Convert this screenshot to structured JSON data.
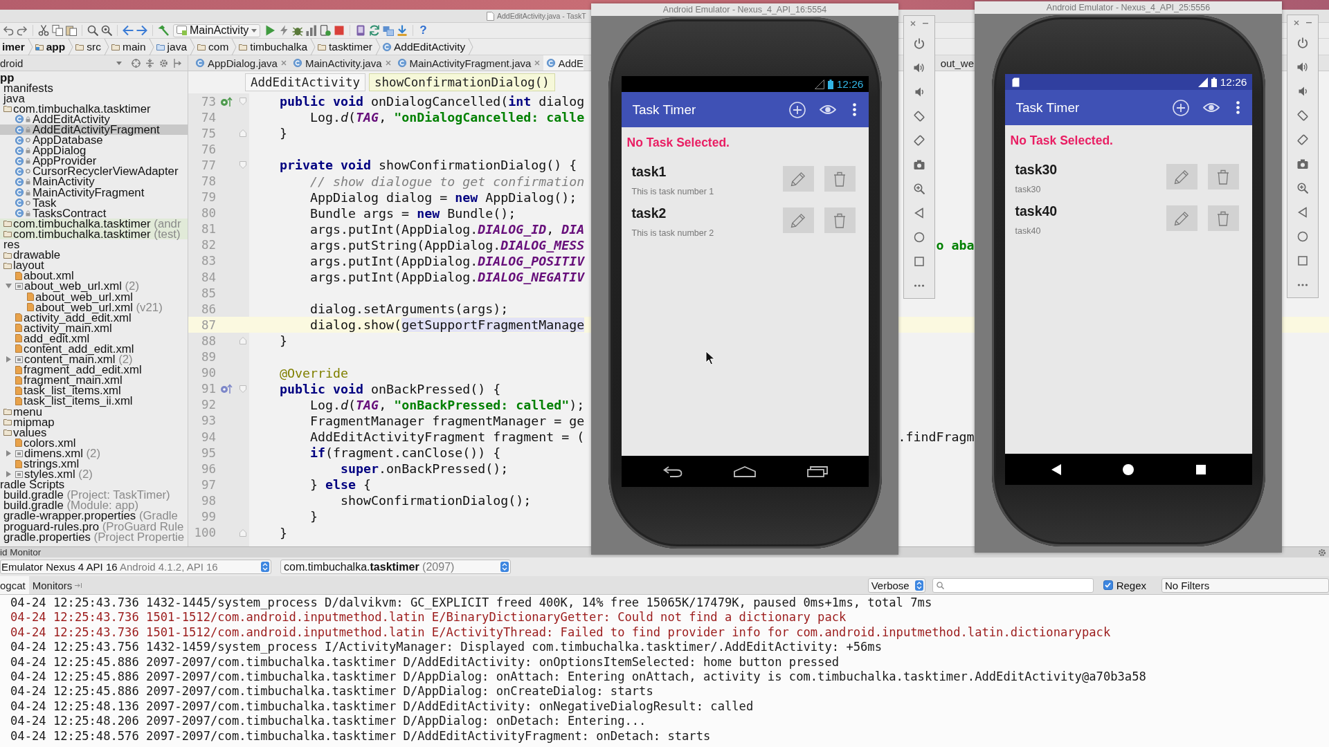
{
  "ide": {
    "window_title": "AddEditActivity.java - TaskT",
    "toolbar": {
      "run_config": "MainActivity",
      "help": "?"
    },
    "breadcrumbs": [
      {
        "label": "imer",
        "kind": "project"
      },
      {
        "label": "app",
        "kind": "module"
      },
      {
        "label": "src",
        "kind": "folder"
      },
      {
        "label": "main",
        "kind": "folder"
      },
      {
        "label": "java",
        "kind": "source-folder"
      },
      {
        "label": "com",
        "kind": "package"
      },
      {
        "label": "timbuchalka",
        "kind": "package"
      },
      {
        "label": "tasktimer",
        "kind": "package"
      },
      {
        "label": "AddEditActivity",
        "kind": "class"
      }
    ],
    "project_view": "droid",
    "tree": [
      {
        "label": "pp",
        "kind": "module",
        "selected": false,
        "children": [
          {
            "label": "manifests",
            "selected": false
          },
          {
            "label": "java",
            "selected": false,
            "children": [
              {
                "label": "com.timbuchalka.tasktimer",
                "kind": "package",
                "selected": false,
                "children": [
                  {
                    "label": "AddEditActivity",
                    "kind": "class",
                    "public": true,
                    "selected": false
                  },
                  {
                    "label": "AddEditActivityFragment",
                    "kind": "class",
                    "public": true,
                    "selected": true
                  },
                  {
                    "label": "AppDatabase",
                    "kind": "class",
                    "public": false,
                    "selected": false
                  },
                  {
                    "label": "AppDialog",
                    "kind": "class",
                    "public": true,
                    "selected": false
                  },
                  {
                    "label": "AppProvider",
                    "kind": "class",
                    "public": true,
                    "selected": false
                  },
                  {
                    "label": "CursorRecyclerViewAdapter",
                    "kind": "class",
                    "public": false,
                    "selected": false
                  },
                  {
                    "label": "MainActivity",
                    "kind": "class",
                    "public": true,
                    "selected": false
                  },
                  {
                    "label": "MainActivityFragment",
                    "kind": "class",
                    "public": true,
                    "selected": false
                  },
                  {
                    "label": "Task",
                    "kind": "class",
                    "public": false,
                    "selected": false
                  },
                  {
                    "label": "TasksContract",
                    "kind": "class",
                    "public": true,
                    "selected": false
                  }
                ]
              },
              {
                "label": "com.timbuchalka.tasktimer",
                "note": "(andr",
                "kind": "test-package",
                "selected": false
              },
              {
                "label": "com.timbuchalka.tasktimer",
                "note": "(test)",
                "kind": "test-package",
                "selected": false
              }
            ]
          },
          {
            "label": "res",
            "selected": false,
            "children": [
              {
                "label": "drawable",
                "kind": "folder",
                "selected": false
              },
              {
                "label": "layout",
                "kind": "folder",
                "selected": false,
                "children": [
                  {
                    "label": "about.xml",
                    "kind": "xml",
                    "selected": false
                  },
                  {
                    "label": "about_web_url.xml",
                    "note": "(2)",
                    "kind": "xml-group",
                    "expanded": true,
                    "selected": false,
                    "children": [
                      {
                        "label": "about_web_url.xml",
                        "kind": "xml",
                        "selected": false
                      },
                      {
                        "label": "about_web_url.xml",
                        "note": "(v21)",
                        "kind": "xml",
                        "selected": false
                      }
                    ]
                  },
                  {
                    "label": "activity_add_edit.xml",
                    "kind": "xml",
                    "selected": false
                  },
                  {
                    "label": "activity_main.xml",
                    "kind": "xml",
                    "selected": false
                  },
                  {
                    "label": "add_edit.xml",
                    "kind": "xml",
                    "selected": false
                  },
                  {
                    "label": "content_add_edit.xml",
                    "kind": "xml",
                    "selected": false
                  },
                  {
                    "label": "content_main.xml",
                    "note": "(2)",
                    "kind": "xml-group",
                    "expanded": false,
                    "selected": false
                  },
                  {
                    "label": "fragment_add_edit.xml",
                    "kind": "xml",
                    "selected": false
                  },
                  {
                    "label": "fragment_main.xml",
                    "kind": "xml",
                    "selected": false
                  },
                  {
                    "label": "task_list_items.xml",
                    "kind": "xml",
                    "selected": false
                  },
                  {
                    "label": "task_list_items_ii.xml",
                    "kind": "xml",
                    "selected": false
                  }
                ]
              },
              {
                "label": "menu",
                "kind": "folder",
                "selected": false
              },
              {
                "label": "mipmap",
                "kind": "folder",
                "selected": false
              },
              {
                "label": "values",
                "kind": "folder",
                "selected": false,
                "children": [
                  {
                    "label": "colors.xml",
                    "kind": "xml",
                    "selected": false
                  },
                  {
                    "label": "dimens.xml",
                    "note": "(2)",
                    "kind": "xml-group",
                    "expanded": false,
                    "selected": false
                  },
                  {
                    "label": "strings.xml",
                    "kind": "xml",
                    "selected": false
                  },
                  {
                    "label": "styles.xml",
                    "note": "(2)",
                    "kind": "xml-group",
                    "expanded": false,
                    "selected": false
                  }
                ]
              }
            ]
          }
        ]
      },
      {
        "label": "radle Scripts",
        "selected": false,
        "children": [
          {
            "label": "build.gradle",
            "note": "(Project: TaskTimer)",
            "selected": false
          },
          {
            "label": "build.gradle",
            "note": "(Module: app)",
            "selected": false
          },
          {
            "label": "gradle-wrapper.properties",
            "note": "(Gradle",
            "selected": false
          },
          {
            "label": "proguard-rules.pro",
            "note": "(ProGuard Rule",
            "selected": false
          },
          {
            "label": "gradle.properties",
            "note": "(Project Propertie",
            "selected": false
          }
        ]
      }
    ],
    "tabs": [
      {
        "label": "AppDialog.java",
        "selected": false
      },
      {
        "label": "MainActivity.java",
        "selected": false
      },
      {
        "label": "MainActivityFragment.java",
        "selected": false
      }
    ],
    "tab_under_emulator": {
      "label": "AddE",
      "selected": true
    },
    "tab_between_windows": "out_we",
    "code_breadcrumbs": [
      {
        "label": "AddEditActivity",
        "selected": false
      },
      {
        "label": "showConfirmationDialog()",
        "selected": true
      }
    ],
    "code_lines": [
      {
        "number": "73",
        "current": false,
        "gutter": [
          {
            "kind": "implements"
          },
          {
            "kind": "fold-start"
          }
        ],
        "code": [
          {
            "kind": "keyword",
            "text": "    public void "
          },
          {
            "kind": "plain",
            "text": "onDialogCancelled("
          },
          {
            "kind": "keyword",
            "text": "int "
          },
          {
            "kind": "plain",
            "text": "dialog"
          }
        ]
      },
      {
        "number": "74",
        "current": false,
        "code": [
          {
            "kind": "plain",
            "text": "        Log."
          },
          {
            "kind": "static",
            "text": "d"
          },
          {
            "kind": "plain",
            "text": "("
          },
          {
            "kind": "constant",
            "text": "TAG"
          },
          {
            "kind": "plain",
            "text": ", "
          },
          {
            "kind": "string",
            "text": "\"onDialogCancelled: calle"
          }
        ]
      },
      {
        "number": "75",
        "current": false,
        "gutter": [
          {
            "kind": "fold-end"
          }
        ],
        "code": [
          {
            "kind": "plain",
            "text": "    }"
          }
        ]
      },
      {
        "number": "76",
        "current": false
      },
      {
        "number": "77",
        "current": false,
        "gutter": [
          {
            "kind": "fold-start"
          }
        ],
        "code": [
          {
            "kind": "keyword",
            "text": "    private void "
          },
          {
            "kind": "plain",
            "text": "showConfirmationDialog() {"
          }
        ]
      },
      {
        "number": "78",
        "current": false,
        "code": [
          {
            "kind": "comment",
            "text": "        // show dialogue to get confirmation"
          }
        ]
      },
      {
        "number": "79",
        "current": false,
        "code": [
          {
            "kind": "plain",
            "text": "        AppDialog dialog = "
          },
          {
            "kind": "keyword",
            "text": "new "
          },
          {
            "kind": "plain",
            "text": "AppDialog();"
          }
        ]
      },
      {
        "number": "80",
        "current": false,
        "code": [
          {
            "kind": "plain",
            "text": "        Bundle args = "
          },
          {
            "kind": "keyword",
            "text": "new "
          },
          {
            "kind": "plain",
            "text": "Bundle();"
          }
        ]
      },
      {
        "number": "81",
        "current": false,
        "code": [
          {
            "kind": "plain",
            "text": "        args.putInt(AppDialog."
          },
          {
            "kind": "constant",
            "text": "DIALOG_ID"
          },
          {
            "kind": "plain",
            "text": ", "
          },
          {
            "kind": "constant",
            "text": "DIA"
          }
        ]
      },
      {
        "number": "82",
        "current": false,
        "code": [
          {
            "kind": "plain",
            "text": "        args.putString(AppDialog."
          },
          {
            "kind": "constant",
            "text": "DIALOG_MESS"
          }
        ],
        "tail": {
          "kind": "string",
          "text": "o aba"
        }
      },
      {
        "number": "83",
        "current": false,
        "code": [
          {
            "kind": "plain",
            "text": "        args.putInt(AppDialog."
          },
          {
            "kind": "constant",
            "text": "DIALOG_POSITIV"
          }
        ]
      },
      {
        "number": "84",
        "current": false,
        "code": [
          {
            "kind": "plain",
            "text": "        args.putInt(AppDialog."
          },
          {
            "kind": "constant",
            "text": "DIALOG_NEGATIV"
          }
        ]
      },
      {
        "number": "85",
        "current": false
      },
      {
        "number": "86",
        "current": false,
        "code": [
          {
            "kind": "plain",
            "text": "        dialog.setArguments(args);"
          }
        ]
      },
      {
        "number": "87",
        "current": true,
        "code": [
          {
            "kind": "plain",
            "text": "        dialog.show("
          },
          {
            "kind": "usage",
            "text": "getSupportFragmentManage"
          }
        ]
      },
      {
        "number": "88",
        "current": false,
        "gutter": [
          {
            "kind": "fold-end"
          }
        ],
        "code": [
          {
            "kind": "plain",
            "text": "    }"
          }
        ]
      },
      {
        "number": "89",
        "current": false
      },
      {
        "number": "90",
        "current": false,
        "code": [
          {
            "kind": "annotation",
            "text": "    @Override"
          }
        ]
      },
      {
        "number": "91",
        "current": false,
        "gutter": [
          {
            "kind": "overrides"
          },
          {
            "kind": "fold-start"
          }
        ],
        "code": [
          {
            "kind": "keyword",
            "text": "    public void "
          },
          {
            "kind": "plain",
            "text": "onBackPressed() {"
          }
        ]
      },
      {
        "number": "92",
        "current": false,
        "code": [
          {
            "kind": "plain",
            "text": "        Log."
          },
          {
            "kind": "static",
            "text": "d"
          },
          {
            "kind": "plain",
            "text": "("
          },
          {
            "kind": "constant",
            "text": "TAG"
          },
          {
            "kind": "plain",
            "text": ", "
          },
          {
            "kind": "string",
            "text": "\"onBackPressed: called\""
          },
          {
            "kind": "plain",
            "text": ");"
          }
        ]
      },
      {
        "number": "93",
        "current": false,
        "code": [
          {
            "kind": "plain",
            "text": "        FragmentManager fragmentManager = ge"
          }
        ]
      },
      {
        "number": "94",
        "current": false,
        "code": [
          {
            "kind": "plain",
            "text": "        AddEditActivityFragment fragment = ("
          }
        ],
        "tail": {
          "kind": "plain",
          "text": ".findFragm"
        }
      },
      {
        "number": "95",
        "current": false,
        "code": [
          {
            "kind": "keyword",
            "text": "        if"
          },
          {
            "kind": "plain",
            "text": "(fragment.canClose()) {"
          }
        ]
      },
      {
        "number": "96",
        "current": false,
        "code": [
          {
            "kind": "keyword",
            "text": "            super"
          },
          {
            "kind": "plain",
            "text": ".onBackPressed();"
          }
        ]
      },
      {
        "number": "97",
        "current": false,
        "code": [
          {
            "kind": "plain",
            "text": "        } "
          },
          {
            "kind": "keyword",
            "text": "else "
          },
          {
            "kind": "plain",
            "text": "{"
          }
        ]
      },
      {
        "number": "98",
        "current": false,
        "code": [
          {
            "kind": "plain",
            "text": "            showConfirmationDialog();"
          }
        ]
      },
      {
        "number": "99",
        "current": false,
        "code": [
          {
            "kind": "plain",
            "text": "        }"
          }
        ]
      },
      {
        "number": "100",
        "current": false,
        "gutter": [
          {
            "kind": "fold-end"
          }
        ],
        "code": [
          {
            "kind": "plain",
            "text": "    }"
          }
        ]
      }
    ]
  },
  "monitor": {
    "title": "id Monitor",
    "device": {
      "name": "Emulator Nexus 4 API 16",
      "detail": "Android 4.1.2, API 16"
    },
    "process": {
      "name": "com.timbuchalka.**tasktimer**",
      "detail": "(2097)"
    },
    "tabs": [
      {
        "label": "ogcat",
        "selected": true
      },
      {
        "label": "Monitors",
        "selected": false
      }
    ],
    "log_level": "Verbose",
    "regex": {
      "label": "Regex",
      "checked": true
    },
    "filter": "No Filters",
    "log_lines": [
      {
        "kind": "plain",
        "text": "04-24 12:25:43.736 1432-1445/system_process D/dalvikvm: GC_EXPLICIT freed 400K, 14% free 15065K/17479K, paused 0ms+1ms, total 7ms"
      },
      {
        "kind": "error",
        "text": "04-24 12:25:43.736 1501-1512/com.android.inputmethod.latin E/BinaryDictionaryGetter: Could not find a dictionary pack"
      },
      {
        "kind": "error",
        "text": "04-24 12:25:43.736 1501-1512/com.android.inputmethod.latin E/ActivityThread: Failed to find provider info for com.android.inputmethod.latin.dictionarypack"
      },
      {
        "kind": "plain",
        "text": "04-24 12:25:43.756 1432-1459/system_process I/ActivityManager: Displayed com.timbuchalka.tasktimer/.AddEditActivity: +56ms"
      },
      {
        "kind": "plain",
        "text": "04-24 12:25:45.886 2097-2097/com.timbuchalka.tasktimer D/AddEditActivity: onOptionsItemSelected: home button pressed"
      },
      {
        "kind": "plain",
        "text": "04-24 12:25:45.886 2097-2097/com.timbuchalka.tasktimer D/AppDialog: onAttach: Entering onAttach, activity is com.timbuchalka.tasktimer.AddEditActivity@a70b3a58"
      },
      {
        "kind": "plain",
        "text": "04-24 12:25:45.886 2097-2097/com.timbuchalka.tasktimer D/AppDialog: onCreateDialog: starts"
      },
      {
        "kind": "plain",
        "text": "04-24 12:25:48.136 2097-2097/com.timbuchalka.tasktimer D/AddEditActivity: onNegativeDialogResult: called"
      },
      {
        "kind": "plain",
        "text": "04-24 12:25:48.206 2097-2097/com.timbuchalka.tasktimer D/AppDialog: onDetach: Entering..."
      },
      {
        "kind": "plain",
        "text": "04-24 12:25:48.576 2097-2097/com.timbuchalka.tasktimer D/AddEditActivityFragment: onDetach: starts"
      }
    ]
  },
  "emulators": [
    {
      "kind": "legacy",
      "title": "Android Emulator - Nexus_4_API_16:5554",
      "clock": "12:26",
      "app_title": "Task Timer",
      "message": "No Task Selected.",
      "tasks": [
        {
          "name": "task1",
          "description": "This is task number 1"
        },
        {
          "name": "task2",
          "description": "This is task number 2"
        }
      ]
    },
    {
      "kind": "nougat",
      "title": "Android Emulator - Nexus_4_API_25:5556",
      "clock": "12:26",
      "app_title": "Task Timer",
      "message": "No Task Selected.",
      "tasks": [
        {
          "name": "task30",
          "description": "task30"
        },
        {
          "name": "task40",
          "description": "task40"
        }
      ]
    }
  ]
}
